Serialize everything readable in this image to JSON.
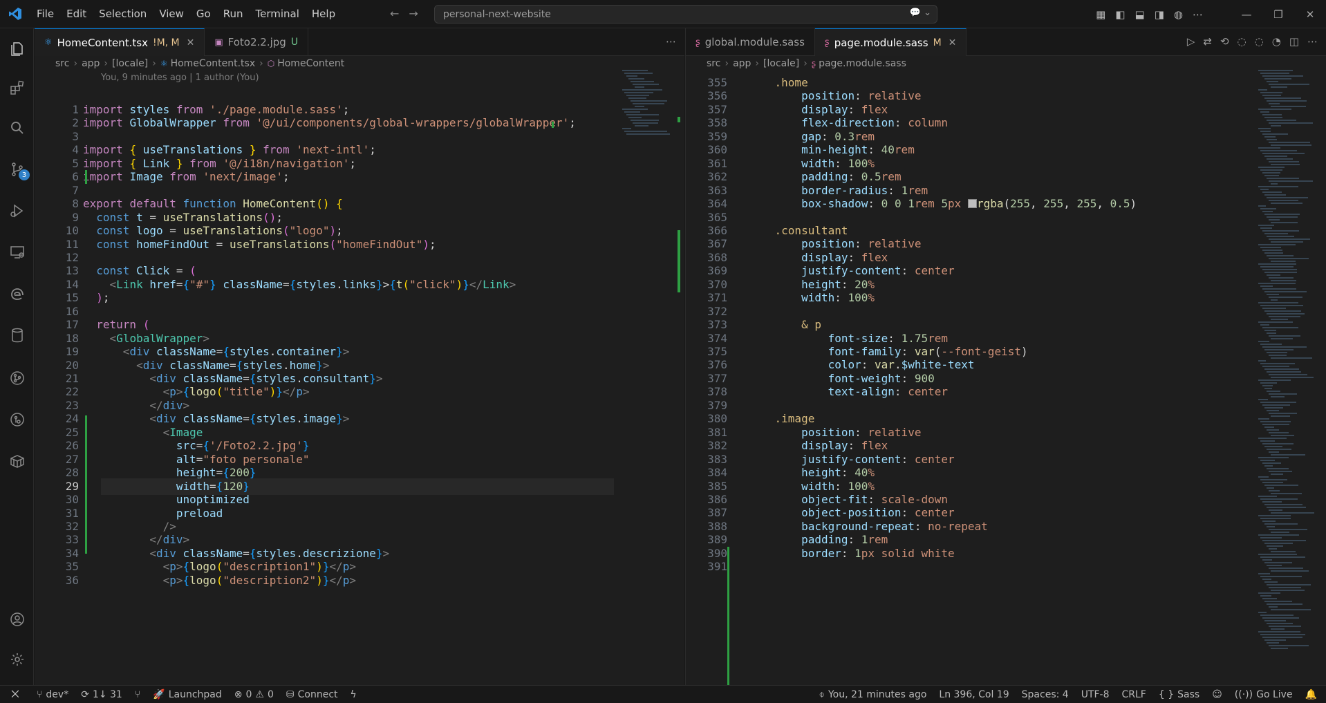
{
  "menu": [
    "File",
    "Edit",
    "Selection",
    "View",
    "Go",
    "Run",
    "Terminal",
    "Help"
  ],
  "command_center": "personal-next-website",
  "activity_badge": "3",
  "left": {
    "tabs": [
      {
        "label": "HomeContent.tsx",
        "status": "!M, M",
        "active": true
      },
      {
        "label": "Foto2.2.jpg",
        "status": "U",
        "active": false
      }
    ],
    "breadcrumb": [
      "src",
      "app",
      "[locale]",
      "HomeContent.tsx",
      "HomeContent"
    ],
    "blame": "You, 9 minutes ago | 1 author (You)",
    "lines": [
      {
        "n": "1",
        "h": "<span class=\"k\">import</span> <span class=\"v\">styles</span> <span class=\"k\">from</span> <span class=\"s\">'./page.module.sass'</span>;"
      },
      {
        "n": "2",
        "h": "<span class=\"k\">import</span> <span class=\"v\">GlobalWrapper</span> <span class=\"k\">from</span> <span class=\"s\">'@/ui/components/global-wrappers/globalWrapper'</span>;"
      },
      {
        "n": "3",
        "h": ""
      },
      {
        "n": "4",
        "h": "<span class=\"k\">import</span> <span class=\"p\">{</span> <span class=\"v\">useTranslations</span> <span class=\"p\">}</span> <span class=\"k\">from</span> <span class=\"s\">'next-intl'</span>;"
      },
      {
        "n": "5",
        "h": "<span class=\"k\">import</span> <span class=\"p\">{</span> <span class=\"v\">Link</span> <span class=\"p\">}</span> <span class=\"k\">from</span> <span class=\"s\">'@/i18n/navigation'</span>;"
      },
      {
        "n": "6",
        "h": "<span class=\"k\">import</span> <span class=\"v\">Image</span> <span class=\"k\">from</span> <span class=\"s\">'next/image'</span>;"
      },
      {
        "n": "7",
        "h": ""
      },
      {
        "n": "8",
        "h": "<span class=\"k\">export</span> <span class=\"k\">default</span> <span class=\"kb\">function</span> <span class=\"f\">HomeContent</span><span class=\"p\">()</span> <span class=\"p\">{</span>"
      },
      {
        "n": "9",
        "h": "  <span class=\"kb\">const</span> <span class=\"v\">t</span> = <span class=\"f\">useTranslations</span><span class=\"p2\">()</span>;"
      },
      {
        "n": "10",
        "h": "  <span class=\"kb\">const</span> <span class=\"v\">logo</span> = <span class=\"f\">useTranslations</span><span class=\"p2\">(</span><span class=\"s\">\"logo\"</span><span class=\"p2\">)</span>;"
      },
      {
        "n": "11",
        "h": "  <span class=\"kb\">const</span> <span class=\"v\">homeFindOut</span> = <span class=\"f\">useTranslations</span><span class=\"p2\">(</span><span class=\"s\">\"homeFindOut\"</span><span class=\"p2\">)</span>;"
      },
      {
        "n": "12",
        "h": ""
      },
      {
        "n": "13",
        "h": "  <span class=\"kb\">const</span> <span class=\"v\">Click</span> = <span class=\"p2\">(</span>"
      },
      {
        "n": "14",
        "h": "    <span class=\"c\">&lt;</span><span class=\"t\">Link</span> <span class=\"a\">href</span>=<span class=\"p3\">{</span><span class=\"s\">\"#\"</span><span class=\"p3\">}</span> <span class=\"a\">className</span>=<span class=\"p3\">{</span><span class=\"v\">styles</span>.<span class=\"v\">links</span><span class=\"p3\">}</span>&gt;<span class=\"p3\">{</span><span class=\"f\">t</span><span class=\"p\">(</span><span class=\"s\">\"click\"</span><span class=\"p\">)</span><span class=\"p3\">}</span><span class=\"c\">&lt;/</span><span class=\"t\">Link</span><span class=\"c\">&gt;</span>"
      },
      {
        "n": "15",
        "h": "  <span class=\"p2\">)</span>;"
      },
      {
        "n": "16",
        "h": ""
      },
      {
        "n": "17",
        "h": "  <span class=\"k\">return</span> <span class=\"p2\">(</span>"
      },
      {
        "n": "18",
        "h": "    <span class=\"c\">&lt;</span><span class=\"t\">GlobalWrapper</span><span class=\"c\">&gt;</span>"
      },
      {
        "n": "19",
        "h": "      <span class=\"c\">&lt;</span><span class=\"tag\">div</span> <span class=\"a\">className</span>=<span class=\"p3\">{</span><span class=\"v\">styles</span>.<span class=\"v\">container</span><span class=\"p3\">}</span><span class=\"c\">&gt;</span>"
      },
      {
        "n": "20",
        "h": "        <span class=\"c\">&lt;</span><span class=\"tag\">div</span> <span class=\"a\">className</span>=<span class=\"p3\">{</span><span class=\"v\">styles</span>.<span class=\"v\">home</span><span class=\"p3\">}</span><span class=\"c\">&gt;</span>"
      },
      {
        "n": "21",
        "h": "          <span class=\"c\">&lt;</span><span class=\"tag\">div</span> <span class=\"a\">className</span>=<span class=\"p3\">{</span><span class=\"v\">styles</span>.<span class=\"v\">consultant</span><span class=\"p3\">}</span><span class=\"c\">&gt;</span>"
      },
      {
        "n": "22",
        "h": "            <span class=\"c\">&lt;</span><span class=\"tag\">p</span><span class=\"c\">&gt;</span><span class=\"p3\">{</span><span class=\"f\">logo</span><span class=\"p\">(</span><span class=\"s\">\"title\"</span><span class=\"p\">)</span><span class=\"p3\">}</span><span class=\"c\">&lt;/</span><span class=\"tag\">p</span><span class=\"c\">&gt;</span>"
      },
      {
        "n": "23",
        "h": "          <span class=\"c\">&lt;/</span><span class=\"tag\">div</span><span class=\"c\">&gt;</span>"
      },
      {
        "n": "24",
        "h": "          <span class=\"c\">&lt;</span><span class=\"tag\">div</span> <span class=\"a\">className</span>=<span class=\"p3\">{</span><span class=\"v\">styles</span>.<span class=\"v\">image</span><span class=\"p3\">}</span><span class=\"c\">&gt;</span>"
      },
      {
        "n": "25",
        "h": "            <span class=\"c\">&lt;</span><span class=\"t\">Image</span>"
      },
      {
        "n": "26",
        "h": "              <span class=\"a\">src</span>=<span class=\"p3\">{</span><span class=\"s\">'/Foto2.2.jpg'</span><span class=\"p3\">}</span>"
      },
      {
        "n": "27",
        "h": "              <span class=\"a\">alt</span>=<span class=\"s\">\"foto personale\"</span>"
      },
      {
        "n": "28",
        "h": "              <span class=\"a\">height</span>=<span class=\"p3\">{</span><span class=\"n\">200</span><span class=\"p3\">}</span>"
      },
      {
        "n": "29",
        "h": "              <span class=\"a\">width</span>=<span class=\"p3\">{</span><span class=\"n\">120</span><span class=\"p3\">}</span>"
      },
      {
        "n": "30",
        "h": "              <span class=\"a\">unoptimized</span>"
      },
      {
        "n": "31",
        "h": "              <span class=\"a\">preload</span>"
      },
      {
        "n": "32",
        "h": "            <span class=\"c\">/&gt;</span>"
      },
      {
        "n": "33",
        "h": "          <span class=\"c\">&lt;/</span><span class=\"tag\">div</span><span class=\"c\">&gt;</span>"
      },
      {
        "n": "34",
        "h": "          <span class=\"c\">&lt;</span><span class=\"tag\">div</span> <span class=\"a\">className</span>=<span class=\"p3\">{</span><span class=\"v\">styles</span>.<span class=\"v\">descrizione</span><span class=\"p3\">}</span><span class=\"c\">&gt;</span>"
      },
      {
        "n": "35",
        "h": "            <span class=\"c\">&lt;</span><span class=\"tag\">p</span><span class=\"c\">&gt;</span><span class=\"p3\">{</span><span class=\"f\">logo</span><span class=\"p\">(</span><span class=\"s\">\"description1\"</span><span class=\"p\">)</span><span class=\"p3\">}</span><span class=\"c\">&lt;/</span><span class=\"tag\">p</span><span class=\"c\">&gt;</span>"
      },
      {
        "n": "36",
        "h": "            <span class=\"c\">&lt;</span><span class=\"tag\">p</span><span class=\"c\">&gt;</span><span class=\"p3\">{</span><span class=\"f\">logo</span><span class=\"p\">(</span><span class=\"s\">\"description2\"</span><span class=\"p\">)</span><span class=\"p3\">}</span><span class=\"c\">&lt;/</span><span class=\"tag\">p</span><span class=\"c\">&gt;</span>"
      }
    ]
  },
  "right": {
    "tabs": [
      {
        "label": "global.module.sass",
        "status": "",
        "active": false
      },
      {
        "label": "page.module.sass",
        "status": "M",
        "active": true
      }
    ],
    "breadcrumb": [
      "src",
      "app",
      "[locale]",
      "page.module.sass"
    ],
    "lines": [
      {
        "n": "355",
        "h": "    <span class=\"cls\">.home</span>"
      },
      {
        "n": "356",
        "h": "        <span class=\"v\">position</span>: <span class=\"val\">relative</span>"
      },
      {
        "n": "357",
        "h": "        <span class=\"v\">display</span>: <span class=\"val\">flex</span>"
      },
      {
        "n": "358",
        "h": "        <span class=\"v\">flex-direction</span>: <span class=\"val\">column</span>"
      },
      {
        "n": "359",
        "h": "        <span class=\"v\">gap</span>: <span class=\"n\">0.3</span><span class=\"val\">rem</span>"
      },
      {
        "n": "360",
        "h": "        <span class=\"v\">min-height</span>: <span class=\"n\">40</span><span class=\"val\">rem</span>"
      },
      {
        "n": "361",
        "h": "        <span class=\"v\">width</span>: <span class=\"n\">100</span><span class=\"val\">%</span>"
      },
      {
        "n": "362",
        "h": "        <span class=\"v\">padding</span>: <span class=\"n\">0.5</span><span class=\"val\">rem</span>"
      },
      {
        "n": "363",
        "h": "        <span class=\"v\">border-radius</span>: <span class=\"n\">1</span><span class=\"val\">rem</span>"
      },
      {
        "n": "364",
        "h": "        <span class=\"v\">box-shadow</span>: <span class=\"n\">0</span> <span class=\"n\">0</span> <span class=\"n\">1</span><span class=\"val\">rem</span> <span class=\"n\">5</span><span class=\"val\">px</span> <span style=\"display:inline-block;width:13px;height:13px;background:#bfbfbf;border:1px solid #888;vertical-align:-1px\"></span><span class=\"f\">rgba</span>(<span class=\"n\">255</span>, <span class=\"n\">255</span>, <span class=\"n\">255</span>, <span class=\"n\">0.5</span>)"
      },
      {
        "n": "365",
        "h": ""
      },
      {
        "n": "366",
        "h": "    <span class=\"cls\">.consultant</span>"
      },
      {
        "n": "367",
        "h": "        <span class=\"v\">position</span>: <span class=\"val\">relative</span>"
      },
      {
        "n": "368",
        "h": "        <span class=\"v\">display</span>: <span class=\"val\">flex</span>"
      },
      {
        "n": "369",
        "h": "        <span class=\"v\">justify-content</span>: <span class=\"val\">center</span>"
      },
      {
        "n": "370",
        "h": "        <span class=\"v\">height</span>: <span class=\"n\">20</span><span class=\"val\">%</span>"
      },
      {
        "n": "371",
        "h": "        <span class=\"v\">width</span>: <span class=\"n\">100</span><span class=\"val\">%</span>"
      },
      {
        "n": "372",
        "h": ""
      },
      {
        "n": "373",
        "h": "        <span class=\"cls\">&amp; p</span>"
      },
      {
        "n": "374",
        "h": "            <span class=\"v\">font-size</span>: <span class=\"n\">1.75</span><span class=\"val\">rem</span>"
      },
      {
        "n": "375",
        "h": "            <span class=\"v\">font-family</span>: <span class=\"f\">var</span>(<span class=\"val\">--font-geist</span>)"
      },
      {
        "n": "376",
        "h": "            <span class=\"v\">color</span>: <span class=\"f\">var</span>.<span class=\"v\">$white-text</span>"
      },
      {
        "n": "377",
        "h": "            <span class=\"v\">font-weight</span>: <span class=\"n\">900</span>"
      },
      {
        "n": "378",
        "h": "            <span class=\"v\">text-align</span>: <span class=\"val\">center</span>"
      },
      {
        "n": "379",
        "h": ""
      },
      {
        "n": "380",
        "h": "    <span class=\"cls\">.image</span>"
      },
      {
        "n": "381",
        "h": "        <span class=\"v\">position</span>: <span class=\"val\">relative</span>"
      },
      {
        "n": "382",
        "h": "        <span class=\"v\">display</span>: <span class=\"val\">flex</span>"
      },
      {
        "n": "383",
        "h": "        <span class=\"v\">justify-content</span>: <span class=\"val\">center</span>"
      },
      {
        "n": "384",
        "h": "        <span class=\"v\">height</span>: <span class=\"n\">40</span><span class=\"val\">%</span>"
      },
      {
        "n": "385",
        "h": "        <span class=\"v\">width</span>: <span class=\"n\">100</span><span class=\"val\">%</span>"
      },
      {
        "n": "386",
        "h": "        <span class=\"v\">object-fit</span>: <span class=\"val\">scale-down</span>"
      },
      {
        "n": "387",
        "h": "        <span class=\"v\">object-position</span>: <span class=\"val\">center</span>"
      },
      {
        "n": "388",
        "h": "        <span class=\"v\">background-repeat</span>: <span class=\"val\">no-repeat</span>"
      },
      {
        "n": "389",
        "h": "        <span class=\"v\">padding</span>: <span class=\"n\">1</span><span class=\"val\">rem</span>"
      },
      {
        "n": "390",
        "h": "        <span class=\"v\">border</span>: <span class=\"n\">1</span><span class=\"val\">px</span> <span class=\"val\">solid</span> <span class=\"val\">white</span>"
      },
      {
        "n": "391",
        "h": ""
      }
    ]
  },
  "status": {
    "branch": "dev*",
    "sync": "1↓ 31",
    "launchpad": "Launchpad",
    "errors": "0",
    "warnings": "0",
    "connect": "Connect",
    "blame": "You, 21 minutes ago",
    "position": "Ln 396, Col 19",
    "spaces": "Spaces: 4",
    "encoding": "UTF-8",
    "eol": "CRLF",
    "language": "Sass",
    "golive": "Go Live"
  }
}
